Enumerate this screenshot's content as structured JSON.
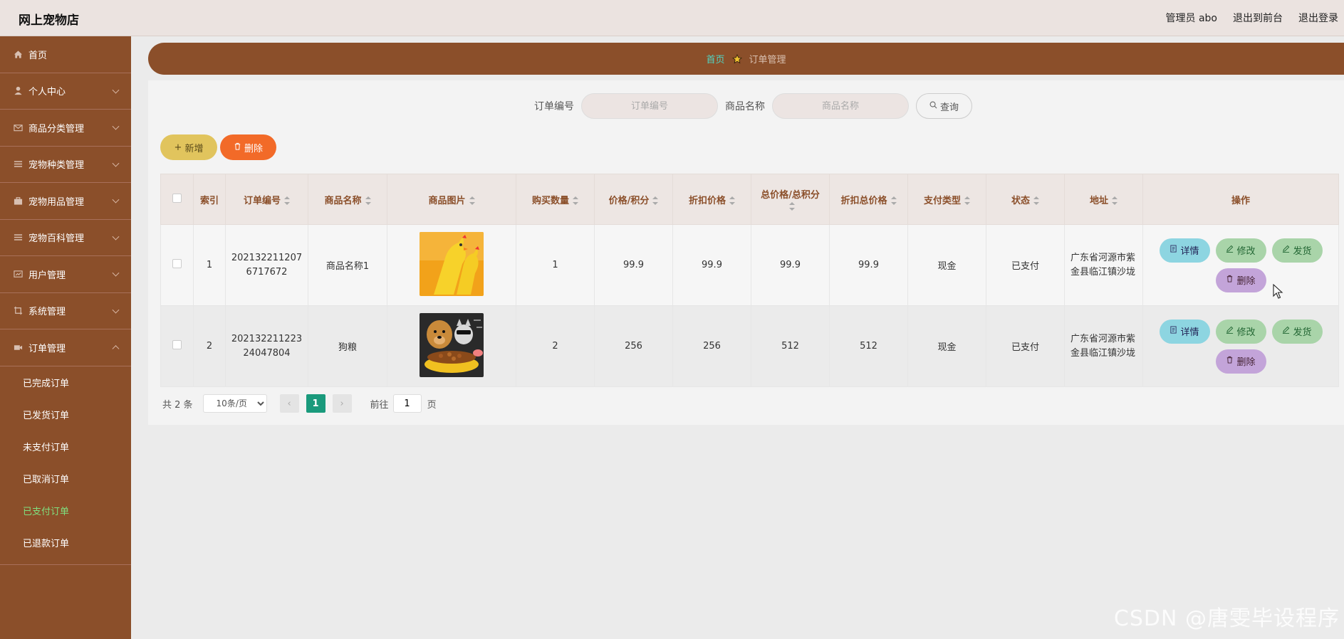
{
  "header": {
    "brand": "网上宠物店",
    "admin": "管理员 abo",
    "back_front": "退出到前台",
    "logout": "退出登录"
  },
  "sidebar": {
    "items": [
      {
        "label": "首页",
        "icon": "home-icon"
      },
      {
        "label": "个人中心",
        "icon": "user-icon"
      },
      {
        "label": "商品分类管理",
        "icon": "mail-icon"
      },
      {
        "label": "宠物种类管理",
        "icon": "list-icon"
      },
      {
        "label": "宠物用品管理",
        "icon": "briefcase-icon"
      },
      {
        "label": "宠物百科管理",
        "icon": "list-icon"
      },
      {
        "label": "用户管理",
        "icon": "message-icon"
      },
      {
        "label": "系统管理",
        "icon": "crop-icon"
      },
      {
        "label": "订单管理",
        "icon": "video-icon"
      }
    ],
    "sub_items": [
      "已完成订单",
      "已发货订单",
      "未支付订单",
      "已取消订单",
      "已支付订单",
      "已退款订单"
    ],
    "active_sub": "已支付订单"
  },
  "breadcrumb": {
    "home": "首页",
    "current": "订单管理"
  },
  "search": {
    "order_label": "订单编号",
    "order_placeholder": "订单编号",
    "product_label": "商品名称",
    "product_placeholder": "商品名称",
    "query": "查询"
  },
  "actions": {
    "add": "新增",
    "delete": "删除"
  },
  "table": {
    "headers": [
      "索引",
      "订单编号",
      "商品名称",
      "商品图片",
      "购买数量",
      "价格/积分",
      "折扣价格",
      "总价格/总积分",
      "折扣总价格",
      "支付类型",
      "状态",
      "地址",
      "操作"
    ],
    "rows": [
      {
        "index": "1",
        "order_no": "2021322112076717672",
        "product": "商品名称1",
        "image": "rubber-chicken-toy",
        "qty": "1",
        "price": "99.9",
        "discount_price": "99.9",
        "total": "99.9",
        "discount_total": "99.9",
        "pay_type": "现金",
        "status": "已支付",
        "address": "广东省河源市紫金县临江镇沙垅"
      },
      {
        "index": "2",
        "order_no": "2021322112232404780 4",
        "product": "狗粮",
        "image": "dog-food-bowl",
        "qty": "2",
        "price": "256",
        "discount_price": "256",
        "total": "512",
        "discount_total": "512",
        "pay_type": "现金",
        "status": "已支付",
        "address": "广东省河源市紫金县临江镇沙垅"
      }
    ],
    "ops": {
      "detail": "详情",
      "edit": "修改",
      "ship": "发货",
      "remove": "删除"
    }
  },
  "pager": {
    "total": "共 2 条",
    "page_size": "10条/页",
    "current": "1",
    "goto": "前往",
    "goto_value": "1",
    "page_unit": "页"
  },
  "watermark": "CSDN @唐雯毕设程序",
  "colors": {
    "brand_brown": "#8b4f2a",
    "active_green": "#1a9a7c",
    "add_yellow": "#e1c45d",
    "delete_orange": "#f26a28"
  }
}
